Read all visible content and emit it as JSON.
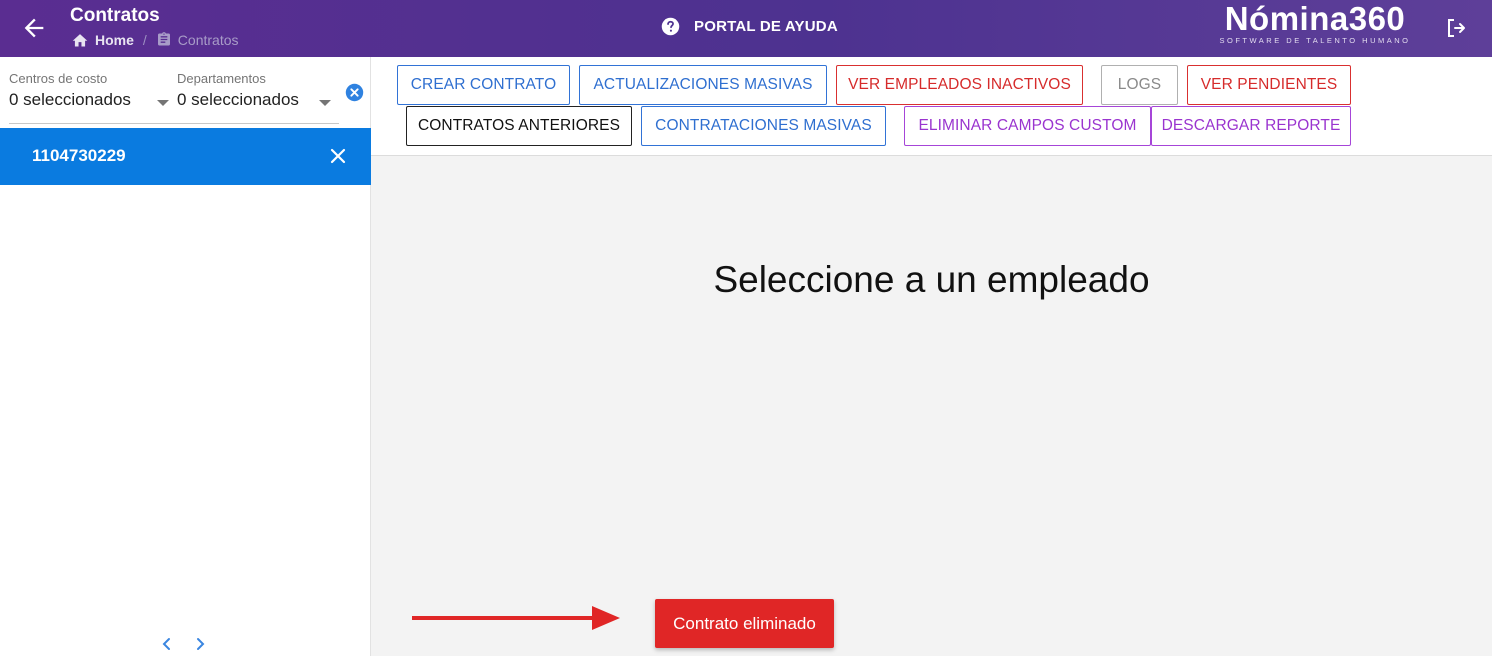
{
  "header": {
    "title": "Contratos",
    "breadcrumb": {
      "home": "Home",
      "separator": "/",
      "current": "Contratos"
    },
    "help_label": "PORTAL DE AYUDA",
    "logo": {
      "name": "Nómina360",
      "tagline": "SOFTWARE DE TALENTO HUMANO"
    }
  },
  "sidebar": {
    "filters": [
      {
        "label": "Centros de costo",
        "value": "0 seleccionados"
      },
      {
        "label": "Departamentos",
        "value": "0 seleccionados"
      }
    ],
    "employees": [
      {
        "id": "1104730229"
      }
    ]
  },
  "toolbar": {
    "row1": [
      "CREAR CONTRATO",
      "ACTUALIZACIONES MASIVAS",
      "VER EMPLEADOS INACTIVOS",
      "LOGS",
      "VER PENDIENTES"
    ],
    "row2": [
      "CONTRATOS ANTERIORES",
      "CONTRATACIONES MASIVAS",
      "ELIMINAR CAMPOS CUSTOM",
      "DESCARGAR REPORTE"
    ]
  },
  "main": {
    "empty_message": "Seleccione a un empleado"
  },
  "toast": {
    "message": "Contrato eliminado"
  },
  "colors": {
    "header_bg": "#4f3190",
    "selected_item": "#0a7be0",
    "blue_action": "#2f6fd0",
    "red_action": "#d62b2b",
    "purple_action": "#9a34cf",
    "toast_bg": "#e02626",
    "annotation_arrow": "#e02626"
  }
}
